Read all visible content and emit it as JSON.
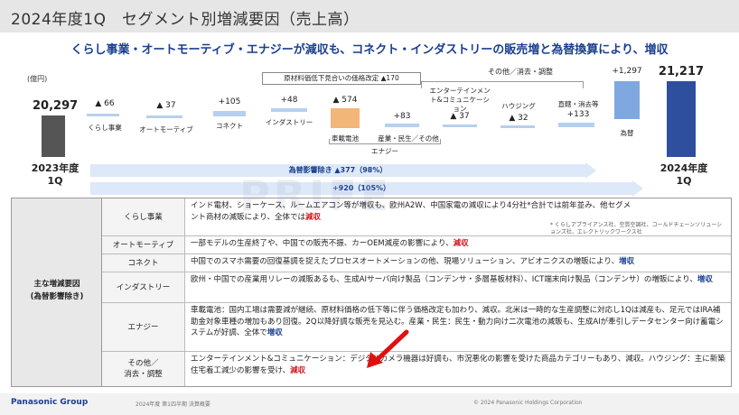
{
  "title": "2024年度1Q　セグメント別増減要因（売上高）",
  "headline": "くらし事業・オートモーティブ・エナジーが減収も、コネクト・インダストリーの販売増と為替換算により、増収",
  "chart": {
    "unit": "(億円)",
    "start": {
      "value": "20,297",
      "period_line1": "2023年度",
      "period_line2": "1Q"
    },
    "end": {
      "value": "21,217",
      "period_line1": "2024年度",
      "period_line2": "1Q"
    },
    "callout": "原材料価低下見合いの価格改定 ▲170",
    "bracket_label": "その他／消去・調整",
    "energy_label": "エナジー",
    "steps": [
      {
        "label": "くらし事業",
        "value": "▲ 66"
      },
      {
        "label": "オートモーティブ",
        "value": "▲ 37"
      },
      {
        "label": "コネクト",
        "value": "+105"
      },
      {
        "label": "インダストリー",
        "value": "+48"
      },
      {
        "label": "車載電池",
        "value": "▲ 574"
      },
      {
        "label": "産業・民生／その他",
        "value": "+83"
      },
      {
        "label": "エンターテインメント&コミュニケーション",
        "value": "▲ 37"
      },
      {
        "label": "ハウジング",
        "value": "▲ 32"
      },
      {
        "label": "直轄・消去等",
        "value": "+133"
      },
      {
        "label": "為替",
        "value": "+1,297"
      }
    ],
    "fx_bar": "為替影響除き ▲377（98%）",
    "total_bar": "+920（105%）",
    "colors": {
      "start": "#555555",
      "end": "#2e4f9e",
      "fx": "#7fa8e0",
      "battery": "#f2b679",
      "step": "#b7cff0"
    }
  },
  "table": {
    "side_label_1": "主な増減要因",
    "side_label_2": "(為替影響除き)",
    "rows": [
      {
        "segment": "くらし事業",
        "text": "インド電材、ショーケース、ルームエアコン等が増収も、欧州A2W、中国家電の減収により4分社*合計では前年並み、他セグメント商材の減販により、全体では",
        "tag": "減収",
        "tag_color": "red",
        "note": "* くらしアプライアンス社、空質空調社、コールドチェーンソリューションズ社、エレクトリックワークス社"
      },
      {
        "segment": "オートモーティブ",
        "text": "一部モデルの生産終了や、中国での販売不振、カーOEM減産の影響により、",
        "tag": "減収",
        "tag_color": "red"
      },
      {
        "segment": "コネクト",
        "text": "中国でのスマホ需要の回復基調を捉えたプロセスオートメーションの他、現場ソリューション、アビオニクスの増販により、",
        "tag": "増収",
        "tag_color": "blue"
      },
      {
        "segment": "インダストリー",
        "text": "欧州・中国での産業用リレーの減販あるも、生成AIサーバ向け製品（コンデンサ・多層基板材料）、ICT端末向け製品（コンデンサ）の増販により、",
        "tag": "増収",
        "tag_color": "blue"
      },
      {
        "segment": "エナジー",
        "text": "車載電池：国内工場は需要減が継続、原材料価格の低下等に伴う価格改定も加わり、減収。北米は一時的な生産調整に対応し1Qは減産も、足元ではIRA補助金対象車種の増加もあり回復。2Q以降好調な販売を見込む。産業・民生：民生・動力向け二次電池の減販も、生成AIが牽引しデータセンター向け蓄電システムが好調、全体で",
        "tag": "増収",
        "tag_color": "blue"
      },
      {
        "segment_line1": "その他／",
        "segment_line2": "消去・調整",
        "text": "エンターテインメント&コミュニケーション：デジタルカメラ機器は好調も、市況悪化の影響を受けた商品カテゴリーもあり、減収。ハウジング：主に新築住宅着工減少の影響を受け、",
        "tag": "減収",
        "tag_color": "red"
      }
    ]
  },
  "watermark": "PRIFE",
  "footer": {
    "logo": "Panasonic Group",
    "mid": "2024年度 第1四半期 決算概要",
    "copyright": "© 2024 Panasonic Holdings Corporation"
  }
}
